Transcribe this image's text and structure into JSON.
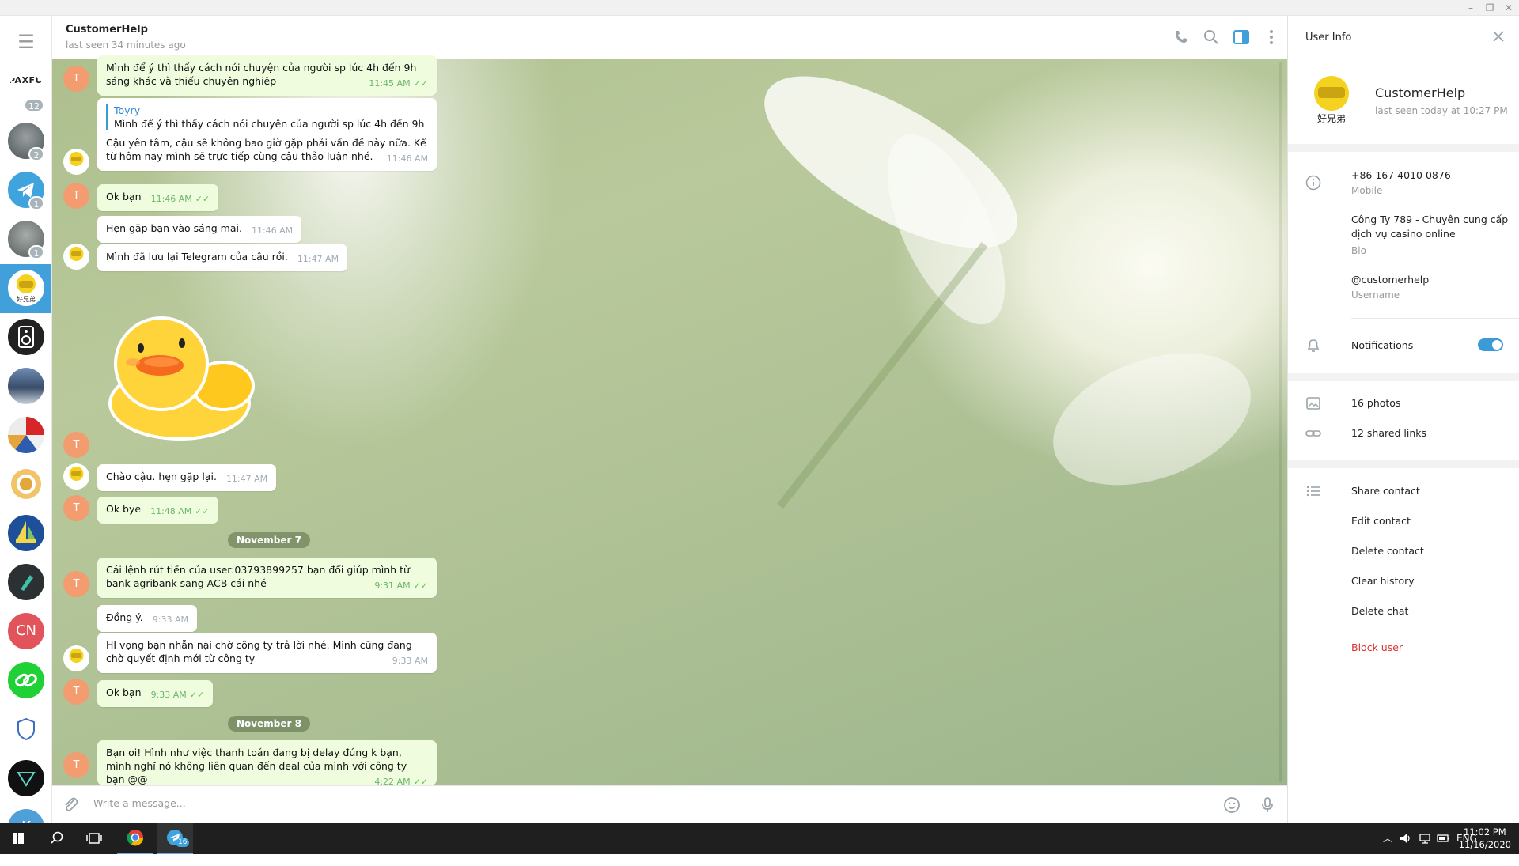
{
  "window": {
    "minimize": "–",
    "restore": "❐",
    "close": "✕"
  },
  "sidebar": {
    "paxful_label": "PAXFUL",
    "chats": [
      {
        "name": "paxful",
        "badge": "12"
      },
      {
        "name": "alien-avatar",
        "badge": "2"
      },
      {
        "name": "telegram",
        "badge": "1"
      },
      {
        "name": "alien-avatar-2",
        "badge": "1"
      },
      {
        "name": "customerhelp",
        "badge": ""
      },
      {
        "name": "speaker",
        "badge": ""
      },
      {
        "name": "city",
        "badge": ""
      },
      {
        "name": "flags",
        "badge": ""
      },
      {
        "name": "coin",
        "badge": ""
      },
      {
        "name": "boat",
        "badge": ""
      },
      {
        "name": "crypto",
        "badge": ""
      },
      {
        "name": "CN",
        "initials": "CN",
        "color": "#e2545b",
        "badge": ""
      },
      {
        "name": "link",
        "badge": ""
      },
      {
        "name": "shield",
        "badge": ""
      },
      {
        "name": "triangle",
        "badge": ""
      },
      {
        "name": "K",
        "initials": "K",
        "color": "#4f9fd9",
        "badge": ""
      }
    ]
  },
  "chat": {
    "title": "CustomerHelp",
    "status": "last seen 34 minutes ago",
    "user_initial": "T",
    "messages": [
      {
        "text": "Mình để ý thì thấy cách nói chuyện của người sp lúc 4h đến 9h sáng khác và thiếu chuyên nghiệp",
        "time": "11:45 AM"
      },
      {
        "reply_name": "Toyry",
        "reply_text": "Mình để ý thì thấy cách nói chuyện của người sp lúc 4h đến 9h sá...",
        "text": "Cậu yên tâm, cậu sẽ không bao giờ gặp phải vấn đề này nữa. Kể từ hôm nay mình sẽ trực tiếp cùng cậu thảo luận nhé.",
        "time": "11:46 AM"
      },
      {
        "text": "Ok bạn",
        "time": "11:46 AM"
      },
      {
        "text": "Hẹn gặp bạn vào sáng mai.",
        "time": "11:46 AM"
      },
      {
        "text": "Mình đã lưu lại Telegram của cậu rồi.",
        "time": "11:47 AM"
      },
      {
        "text": "Chào cậu. hẹn gặp lại.",
        "time": "11:47 AM"
      },
      {
        "text": "Ok bye",
        "time": "11:48 AM"
      },
      {
        "text": "Cái lệnh rút tiền của user:03793899257 bạn đổi giúp mình từ bank agribank sang ACB cái nhé",
        "time": "9:31 AM"
      },
      {
        "text": "Đồng ý.",
        "time": "9:33 AM"
      },
      {
        "text": "HI vọng bạn nhẫn nại chờ công ty trả lời nhé. Mình cũng đang chờ quyết định mới từ công ty",
        "time": "9:33 AM"
      },
      {
        "text": "Ok bạn",
        "time": "9:33 AM"
      },
      {
        "text": "Bạn ơi! Hình như việc thanh toán đang bị delay đúng k bạn, mình nghĩ nó không liên quan đến deal của mình với công ty bạn @@",
        "time": "4:22 AM"
      }
    ],
    "dates": [
      "November 7",
      "November 8"
    ],
    "composer_placeholder": "Write a message..."
  },
  "user_info": {
    "title": "User Info",
    "name": "CustomerHelp",
    "last_seen": "last seen today at 10:27 PM",
    "phone": "+86 167 4010 0876",
    "phone_label": "Mobile",
    "bio": "Công Ty 789 - Chuyên cung cấp dịch vụ casino online",
    "bio_label": "Bio",
    "username": "@customerhelp",
    "username_label": "Username",
    "notifications": "Notifications",
    "notifications_on": true,
    "photos": "16 photos",
    "links": "12 shared links",
    "actions": [
      "Share contact",
      "Edit contact",
      "Delete contact",
      "Clear history",
      "Delete chat"
    ],
    "block": "Block user"
  },
  "taskbar": {
    "lang": "ENG",
    "time": "11:02 PM",
    "date": "11/16/2020",
    "telegram_badge": "16"
  },
  "colors": {
    "accent": "#419fd9",
    "outgoing": "#effdde",
    "danger": "#d33333"
  }
}
